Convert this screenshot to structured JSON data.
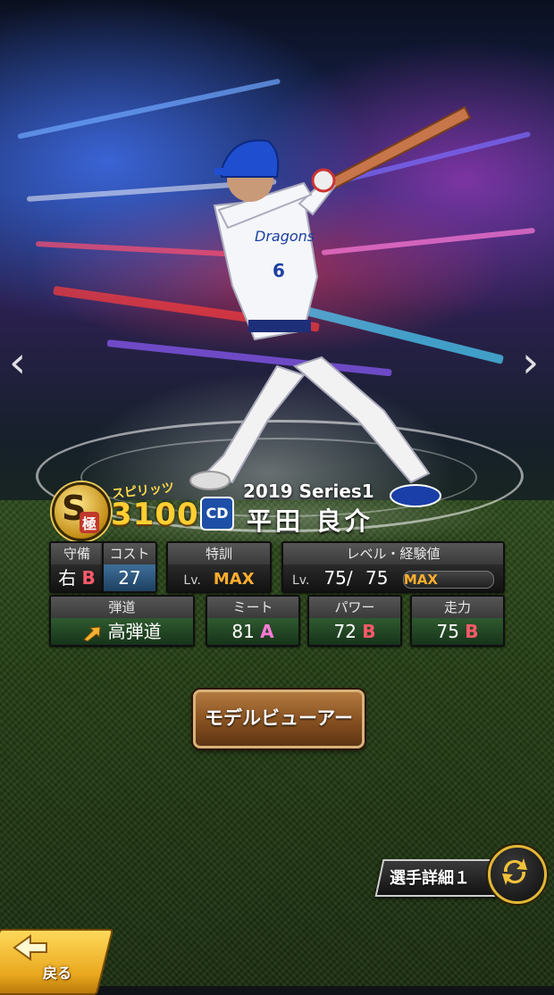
{
  "card": {
    "spirits_label": "スピリッツ",
    "spirits_value": "3100",
    "rank_letter": "S",
    "rank_sub": "極",
    "team_logo_text": "CD",
    "series": "2019 Series1",
    "player_name": "平田 良介",
    "jersey_number": "6"
  },
  "stats_row1": {
    "defense": {
      "header": "守備",
      "hand": "右",
      "grade": "B"
    },
    "cost": {
      "header": "コスト",
      "value": "27"
    },
    "training": {
      "header": "特訓",
      "lv": "Lv.",
      "value": "MAX"
    },
    "level": {
      "header": "レベル・経験値",
      "lv": "Lv.",
      "current": "75",
      "separator": "/",
      "max": "75",
      "exp_label": "MAX"
    }
  },
  "stats_row2": {
    "trajectory": {
      "header": "弾道",
      "value": "高弾道"
    },
    "meet": {
      "header": "ミート",
      "value": "81",
      "grade": "A"
    },
    "power": {
      "header": "パワー",
      "value": "72",
      "grade": "B"
    },
    "speed": {
      "header": "走力",
      "value": "75",
      "grade": "B"
    }
  },
  "buttons": {
    "model_viewer": "モデルビューアー",
    "player_detail": "選手詳細１",
    "back": "戻る"
  },
  "icons": {
    "prev": "chevron-left-icon",
    "next": "chevron-right-icon",
    "swap": "swap-arrows-icon",
    "back": "back-arrow-icon",
    "trajectory": "trajectory-arrow-icon"
  },
  "colors": {
    "grade_b": "#ff5a6a",
    "grade_a": "#ff7ad8",
    "max": "#ffae2c",
    "spirits": "#ffcf33",
    "team_blue": "#1e4fa6"
  }
}
